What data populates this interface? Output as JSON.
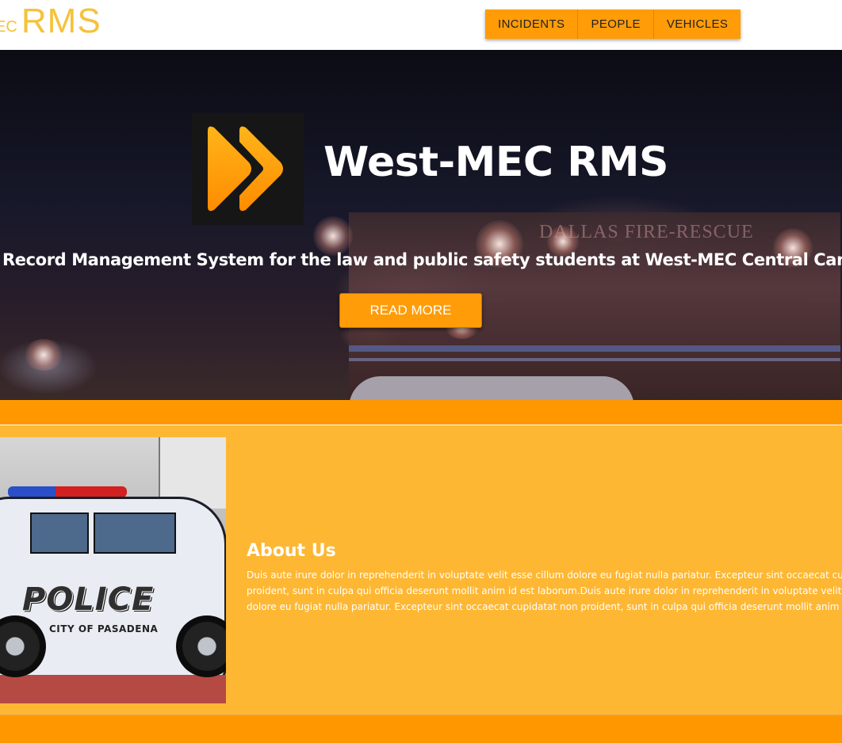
{
  "header": {
    "logo_prefix": "EC",
    "logo_text": "RMS",
    "nav": [
      {
        "label": "INCIDENTS"
      },
      {
        "label": "PEOPLE"
      },
      {
        "label": "VEHICLES"
      }
    ]
  },
  "hero": {
    "title": "West-MEC RMS",
    "subtitle": "Record Management System for the law and public safety students at West-MEC Central Campus",
    "button_label": "READ MORE",
    "truck_text": "DALLAS FIRE-RESCUE",
    "logo_icon": "double-chevron-icon"
  },
  "about": {
    "title": "About Us",
    "lines": [
      "Duis aute irure dolor in reprehenderit in voluptate velit esse cillum dolore eu fugiat nulla pariatur. Excepteur sint occaecat cupidatat non",
      "proident, sunt in culpa qui officia deserunt mollit anim id est laborum.Duis aute irure dolor in reprehenderit in voluptate velit esse cillum",
      "dolore eu fugiat nulla pariatur. Excepteur sint occaecat cupidatat non proident, sunt in culpa qui officia deserunt mollit anim id est laborum."
    ],
    "image_text_main": "POLICE",
    "image_text_sub": "CITY OF PASADENA"
  },
  "colors": {
    "accent": "#ff9c08",
    "band": "#ff9800",
    "about_bg": "#feb733",
    "logo": "#f6c23a"
  }
}
